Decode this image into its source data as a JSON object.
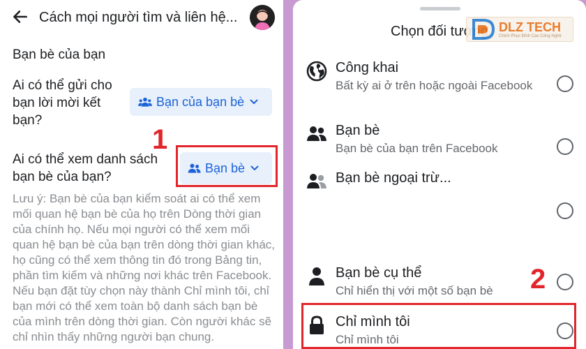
{
  "left": {
    "header": {
      "title": "Cách mọi người tìm và liên hệ..."
    },
    "section_title": "Bạn bè của bạn",
    "friend_request": {
      "question": "Ai có thể gửi cho bạn lời mời kết bạn?",
      "value": "Bạn của bạn bè"
    },
    "friend_list": {
      "question": "Ai có thể xem danh sách bạn bè của bạn?",
      "value": "Bạn bè"
    },
    "note": "Lưu ý: Bạn bè của bạn kiểm soát ai có thể xem mối quan hệ bạn bè của họ trên Dòng thời gian của chính họ. Nếu mọi người có thể xem mối quan hệ bạn bè của bạn trên dòng thời gian khác, họ cũng có thể xem thông tin đó trong Bảng tin, phần tìm kiếm và những nơi khác trên Facebook. Nếu bạn đặt tùy chọn này thành Chỉ mình tôi, chỉ bạn mới có thể xem toàn bộ danh sách bạn bè của mình trên dòng thời gian. Còn người khác sẽ chỉ nhìn thấy những người bạn chung.",
    "step_label": "1"
  },
  "right": {
    "title": "Chọn đối tượng",
    "logo": {
      "text": "DLZ TECH",
      "tagline": "Chinh Phục Đỉnh Cao Công Nghệ"
    },
    "options": [
      {
        "title": "Công khai",
        "subtitle": "Bất kỳ ai ở trên hoặc ngoài Facebook",
        "icon": "globe-icon"
      },
      {
        "title": "Bạn bè",
        "subtitle": "Bạn bè của bạn trên Facebook",
        "icon": "friends-icon"
      },
      {
        "title": "Bạn bè ngoại trừ...",
        "subtitle": "",
        "icon": "friends-except-icon"
      },
      {
        "title": "Bạn bè cụ thể",
        "subtitle": "Chỉ hiển thị với một số bạn bè",
        "icon": "person-icon"
      },
      {
        "title": "Chỉ mình tôi",
        "subtitle": "Chỉ mình tôi",
        "icon": "lock-icon"
      }
    ],
    "step_label": "2"
  },
  "colors": {
    "accent_blue": "#1d63d8",
    "pill_bg": "#e7f0fb",
    "highlight_red": "#e1252b",
    "backdrop": "#c79bd1"
  }
}
